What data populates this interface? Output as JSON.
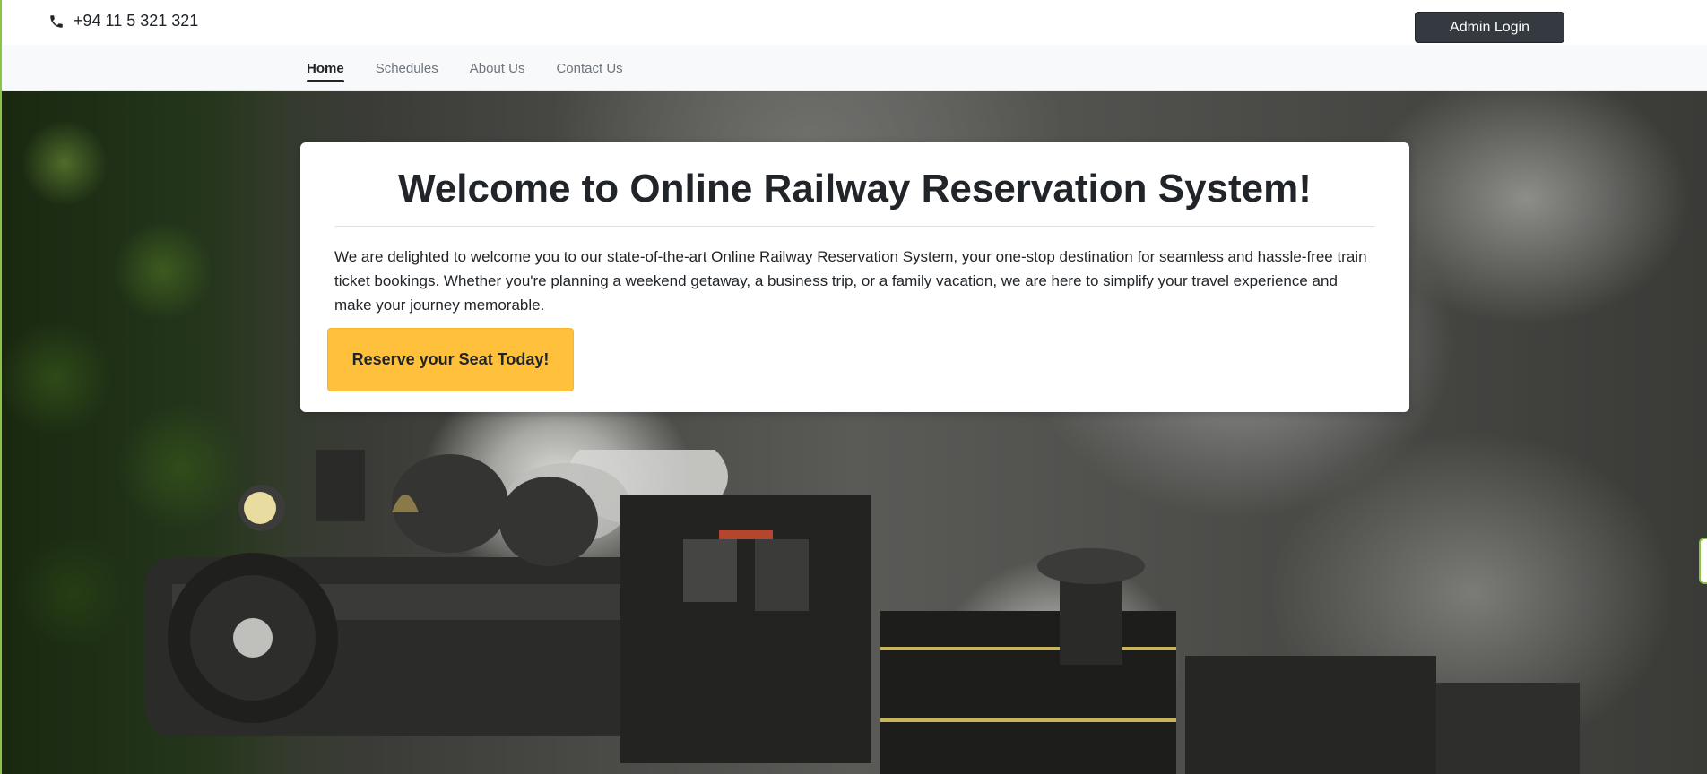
{
  "topbar": {
    "phone_icon": "phone-icon",
    "phone_number": "+94 11 5 321 321",
    "admin_login_label": "Admin Login"
  },
  "nav": {
    "items": [
      {
        "label": "Home",
        "active": true
      },
      {
        "label": "Schedules",
        "active": false
      },
      {
        "label": "About Us",
        "active": false
      },
      {
        "label": "Contact Us",
        "active": false
      }
    ]
  },
  "hero": {
    "title": "Welcome to Online Railway Reservation System!",
    "description": "We are delighted to welcome you to our state-of-the-art Online Railway Reservation System, your one-stop destination for seamless and hassle-free train ticket bookings. Whether you're planning a weekend getaway, a business trip, or a family vacation, we are here to simplify your travel experience and make your journey memorable.",
    "cta_label": "Reserve your Seat Today!"
  },
  "colors": {
    "accent": "#ffc13b",
    "dark_button": "#343a40",
    "nav_background": "#f8f9fa"
  }
}
